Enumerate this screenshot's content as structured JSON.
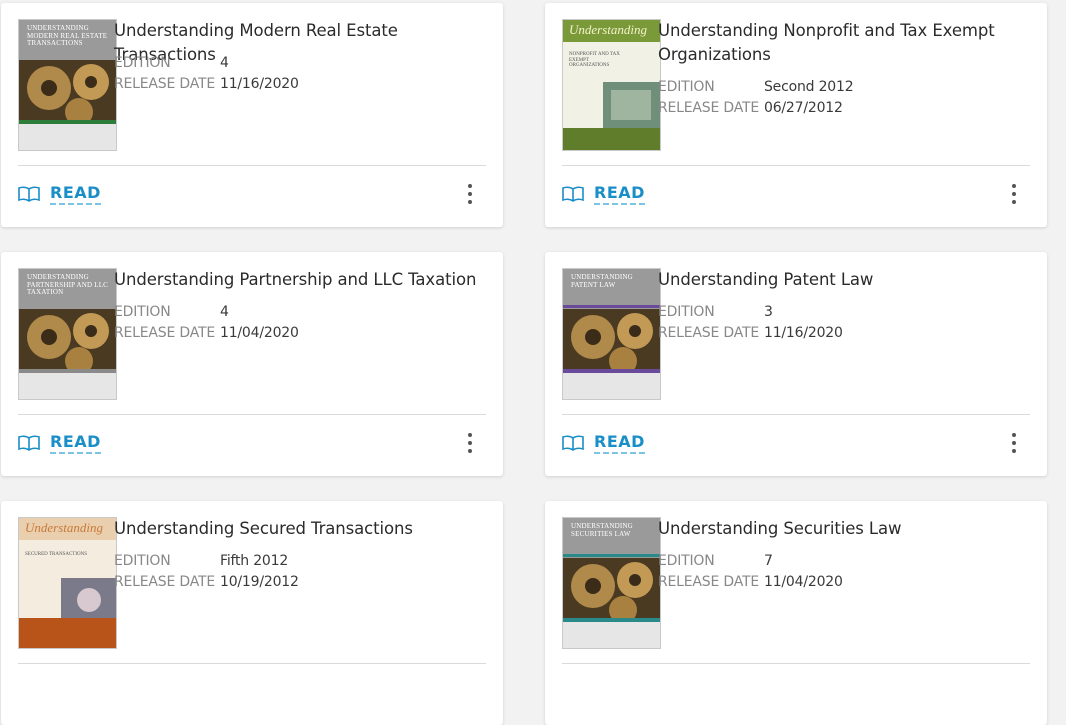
{
  "labels": {
    "edition": "EDITION",
    "release_date": "RELEASE DATE",
    "read": "READ"
  },
  "books": [
    {
      "title": "Understanding Modern Real Estate Transactions",
      "edition": "4",
      "release_date": "11/16/2020",
      "cover_text": "Understanding Modern Real Estate Transactions"
    },
    {
      "title": "Understanding Nonprofit and Tax Exempt Organizations",
      "edition": "Second 2012",
      "release_date": "06/27/2012",
      "cover_script": "Understanding",
      "cover_text": "Nonprofit and Tax Exempt Organizations"
    },
    {
      "title": "Understanding Partnership and LLC Taxation",
      "edition": "4",
      "release_date": "11/04/2020",
      "cover_text": "Understanding Partnership and LLC Taxation"
    },
    {
      "title": "Understanding Patent Law",
      "edition": "3",
      "release_date": "11/16/2020",
      "cover_text": "Understanding Patent Law"
    },
    {
      "title": "Understanding Secured Transactions",
      "edition": "Fifth 2012",
      "release_date": "10/19/2012",
      "cover_script": "Understanding",
      "cover_text": "Secured Transactions"
    },
    {
      "title": "Understanding Securities Law",
      "edition": "7",
      "release_date": "11/04/2020",
      "cover_text": "Understanding Securities Law"
    }
  ],
  "colors": {
    "accent": "#1a8ec7",
    "card_bg": "#ffffff",
    "page_bg": "#f2f2f2"
  }
}
